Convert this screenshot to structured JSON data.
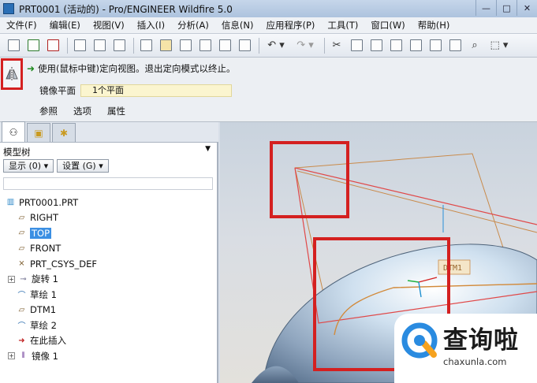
{
  "window": {
    "title": "PRT0001 (活动的) - Pro/ENGINEER Wildfire 5.0",
    "controls": [
      "—",
      "□",
      "✕"
    ]
  },
  "menubar": [
    "文件(F)",
    "编辑(E)",
    "视图(V)",
    "插入(I)",
    "分析(A)",
    "信息(N)",
    "应用程序(P)",
    "工具(T)",
    "窗口(W)",
    "帮助(H)"
  ],
  "dashboard": {
    "hint": "使用(鼠标中键)定向视图。退出定向模式以终止。",
    "mirror_plane_label": "镜像平面",
    "mirror_plane_value": "1个平面",
    "tabs": [
      "参照",
      "选项",
      "属性"
    ]
  },
  "model_tree": {
    "header": "模型树",
    "show_button": "显示 (0) ▾",
    "settings_button": "设置 (G) ▾",
    "items": [
      {
        "label": "PRT0001.PRT",
        "icon": "part-icon",
        "expandable": false,
        "indent": 0
      },
      {
        "label": "RIGHT",
        "icon": "datum-plane-icon",
        "expandable": false,
        "indent": 1
      },
      {
        "label": "TOP",
        "icon": "datum-plane-icon",
        "expandable": false,
        "indent": 1,
        "selected": true
      },
      {
        "label": "FRONT",
        "icon": "datum-plane-icon",
        "expandable": false,
        "indent": 1
      },
      {
        "label": "PRT_CSYS_DEF",
        "icon": "csys-icon",
        "expandable": false,
        "indent": 1
      },
      {
        "label": "旋转 1",
        "icon": "revolve-icon",
        "expandable": true,
        "indent": 0
      },
      {
        "label": "草绘 1",
        "icon": "sketch-icon",
        "expandable": false,
        "indent": 1
      },
      {
        "label": "DTM1",
        "icon": "datum-plane-icon",
        "expandable": false,
        "indent": 1
      },
      {
        "label": "草绘 2",
        "icon": "sketch-icon",
        "expandable": false,
        "indent": 1
      },
      {
        "label": "在此插入",
        "icon": "insert-here-arrow-icon",
        "expandable": false,
        "indent": 1
      },
      {
        "label": "镜像 1",
        "icon": "mirror-icon",
        "expandable": true,
        "indent": 0
      }
    ]
  },
  "graphics": {
    "datum_label": "DTM1"
  },
  "watermark": {
    "text": "查询啦",
    "url": "chaxunla.com"
  },
  "colors": {
    "highlight_red": "#d42020",
    "selection_blue": "#3b8fe3",
    "collector_yellow": "#fbf5cf",
    "watermark_blue": "#2a8be0",
    "watermark_orange": "#f6a21e"
  }
}
